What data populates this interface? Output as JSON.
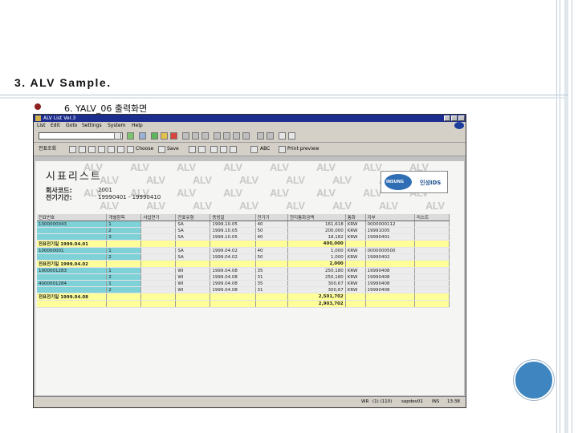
{
  "slide": {
    "title": "3. ALV Sample.",
    "bullet": "6. YALV_06 출력화면"
  },
  "window": {
    "title": "ALV List Ver.3",
    "menu": [
      "List",
      "Edit",
      "Goto",
      "Settings",
      "System",
      "Help"
    ],
    "toolbar2": [
      "전표조회",
      "Choose",
      "Save",
      "ABC",
      "Print preview"
    ]
  },
  "report": {
    "title": "시표리스트",
    "fields": [
      {
        "label": "회사코드:",
        "value": "2001"
      },
      {
        "label": "전기기간:",
        "value": "19990401 - 19990410"
      }
    ],
    "watermark": "ALV",
    "logo_left": "INSUNG",
    "logo_right": "인성IDS"
  },
  "grid": {
    "columns": [
      "전표번호",
      "개별항목",
      "사업연기",
      "전표유형",
      "증빙일",
      "전기기",
      "현지통화금액",
      "통화",
      "지부",
      "리스트"
    ],
    "rows": [
      {
        "type": "data",
        "cells": [
          "1300000043",
          "1",
          "",
          "SA",
          "1999.10.05",
          "40",
          "161,618",
          "KRW",
          "0000000112",
          ""
        ]
      },
      {
        "type": "data",
        "cells": [
          "",
          "2",
          "",
          "SA",
          "1999.10.05",
          "50",
          "200,000",
          "KRW",
          "19991005",
          ""
        ]
      },
      {
        "type": "data",
        "cells": [
          "",
          "3",
          "",
          "SA",
          "1999.10.05",
          "40",
          "18,182",
          "KRW",
          "19990401",
          ""
        ]
      },
      {
        "type": "sub",
        "cells": [
          "전표전기일 1999.04.01",
          "",
          "",
          "",
          "",
          "",
          "400,000",
          "",
          "",
          ""
        ]
      },
      {
        "type": "data",
        "cells": [
          "100000001",
          "1",
          "",
          "SA",
          "1999.04.02",
          "40",
          "1,000",
          "KRW",
          "0000000500",
          ""
        ]
      },
      {
        "type": "data",
        "cells": [
          "",
          "2",
          "",
          "SA",
          "1999.04.02",
          "50",
          "1,000",
          "KRW",
          "19990402",
          ""
        ]
      },
      {
        "type": "sub",
        "cells": [
          "전표전기일 1999.04.02",
          "",
          "",
          "",
          "",
          "",
          "2,000",
          "",
          "",
          ""
        ]
      },
      {
        "type": "data",
        "cells": [
          "1900001283",
          "1",
          "",
          "WI",
          "1999.04.08",
          "35",
          "250,180",
          "KRW",
          "19990408",
          ""
        ]
      },
      {
        "type": "data",
        "cells": [
          "",
          "2",
          "",
          "WI",
          "1999.04.08",
          "31",
          "250,180",
          "KRW",
          "19990408",
          ""
        ]
      },
      {
        "type": "data",
        "cells": [
          "4000001284",
          "1",
          "",
          "WI",
          "1999.04.08",
          "35",
          "300,67",
          "KRW",
          "19990408",
          ""
        ]
      },
      {
        "type": "data",
        "cells": [
          "",
          "2",
          "",
          "WI",
          "1999.04.08",
          "31",
          "300,67",
          "KRW",
          "19990408",
          ""
        ]
      },
      {
        "type": "sub",
        "cells": [
          "전표전기일 1999.04.08",
          "",
          "",
          "",
          "",
          "",
          "2,501,702",
          "",
          "",
          ""
        ]
      },
      {
        "type": "sub",
        "cells": [
          "",
          "",
          "",
          "",
          "",
          "",
          "2,903,702",
          "",
          "",
          ""
        ]
      }
    ]
  },
  "status": [
    "WR",
    "(1) (110)",
    "sapdev01",
    "INS",
    "13:38"
  ],
  "colors": {
    "title_bar": "#1c2d8f",
    "key_cell": "#7fd1d8",
    "subtotal": "#ffff99",
    "accent_circle": "#3f85bf",
    "bullet": "#8e1f1f"
  }
}
